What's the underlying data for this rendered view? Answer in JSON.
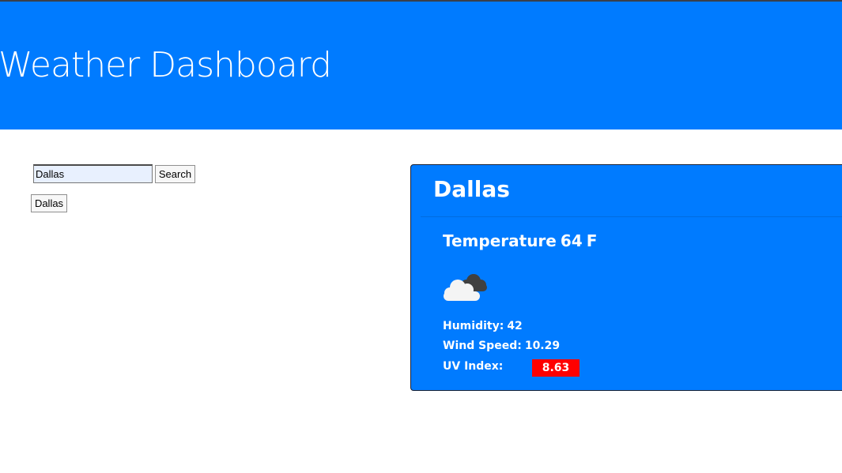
{
  "header": {
    "title": "Weather Dashboard",
    "background_color": "#007bff"
  },
  "search": {
    "value": "Dallas",
    "button_label": "Search"
  },
  "history": {
    "items": [
      {
        "label": "Dallas"
      }
    ]
  },
  "current_weather": {
    "city": "Dallas",
    "temperature_label": "Temperature",
    "temperature_value": "64",
    "temperature_unit": "F",
    "icon": "cloud-icon",
    "humidity_label": "Humidity:",
    "humidity_value": "42",
    "wind_label": "Wind Speed:",
    "wind_value": "10.29",
    "uv_label": "UV Index:",
    "uv_value": "8.63",
    "uv_color": "#ff0000",
    "card_color": "#007bff"
  }
}
